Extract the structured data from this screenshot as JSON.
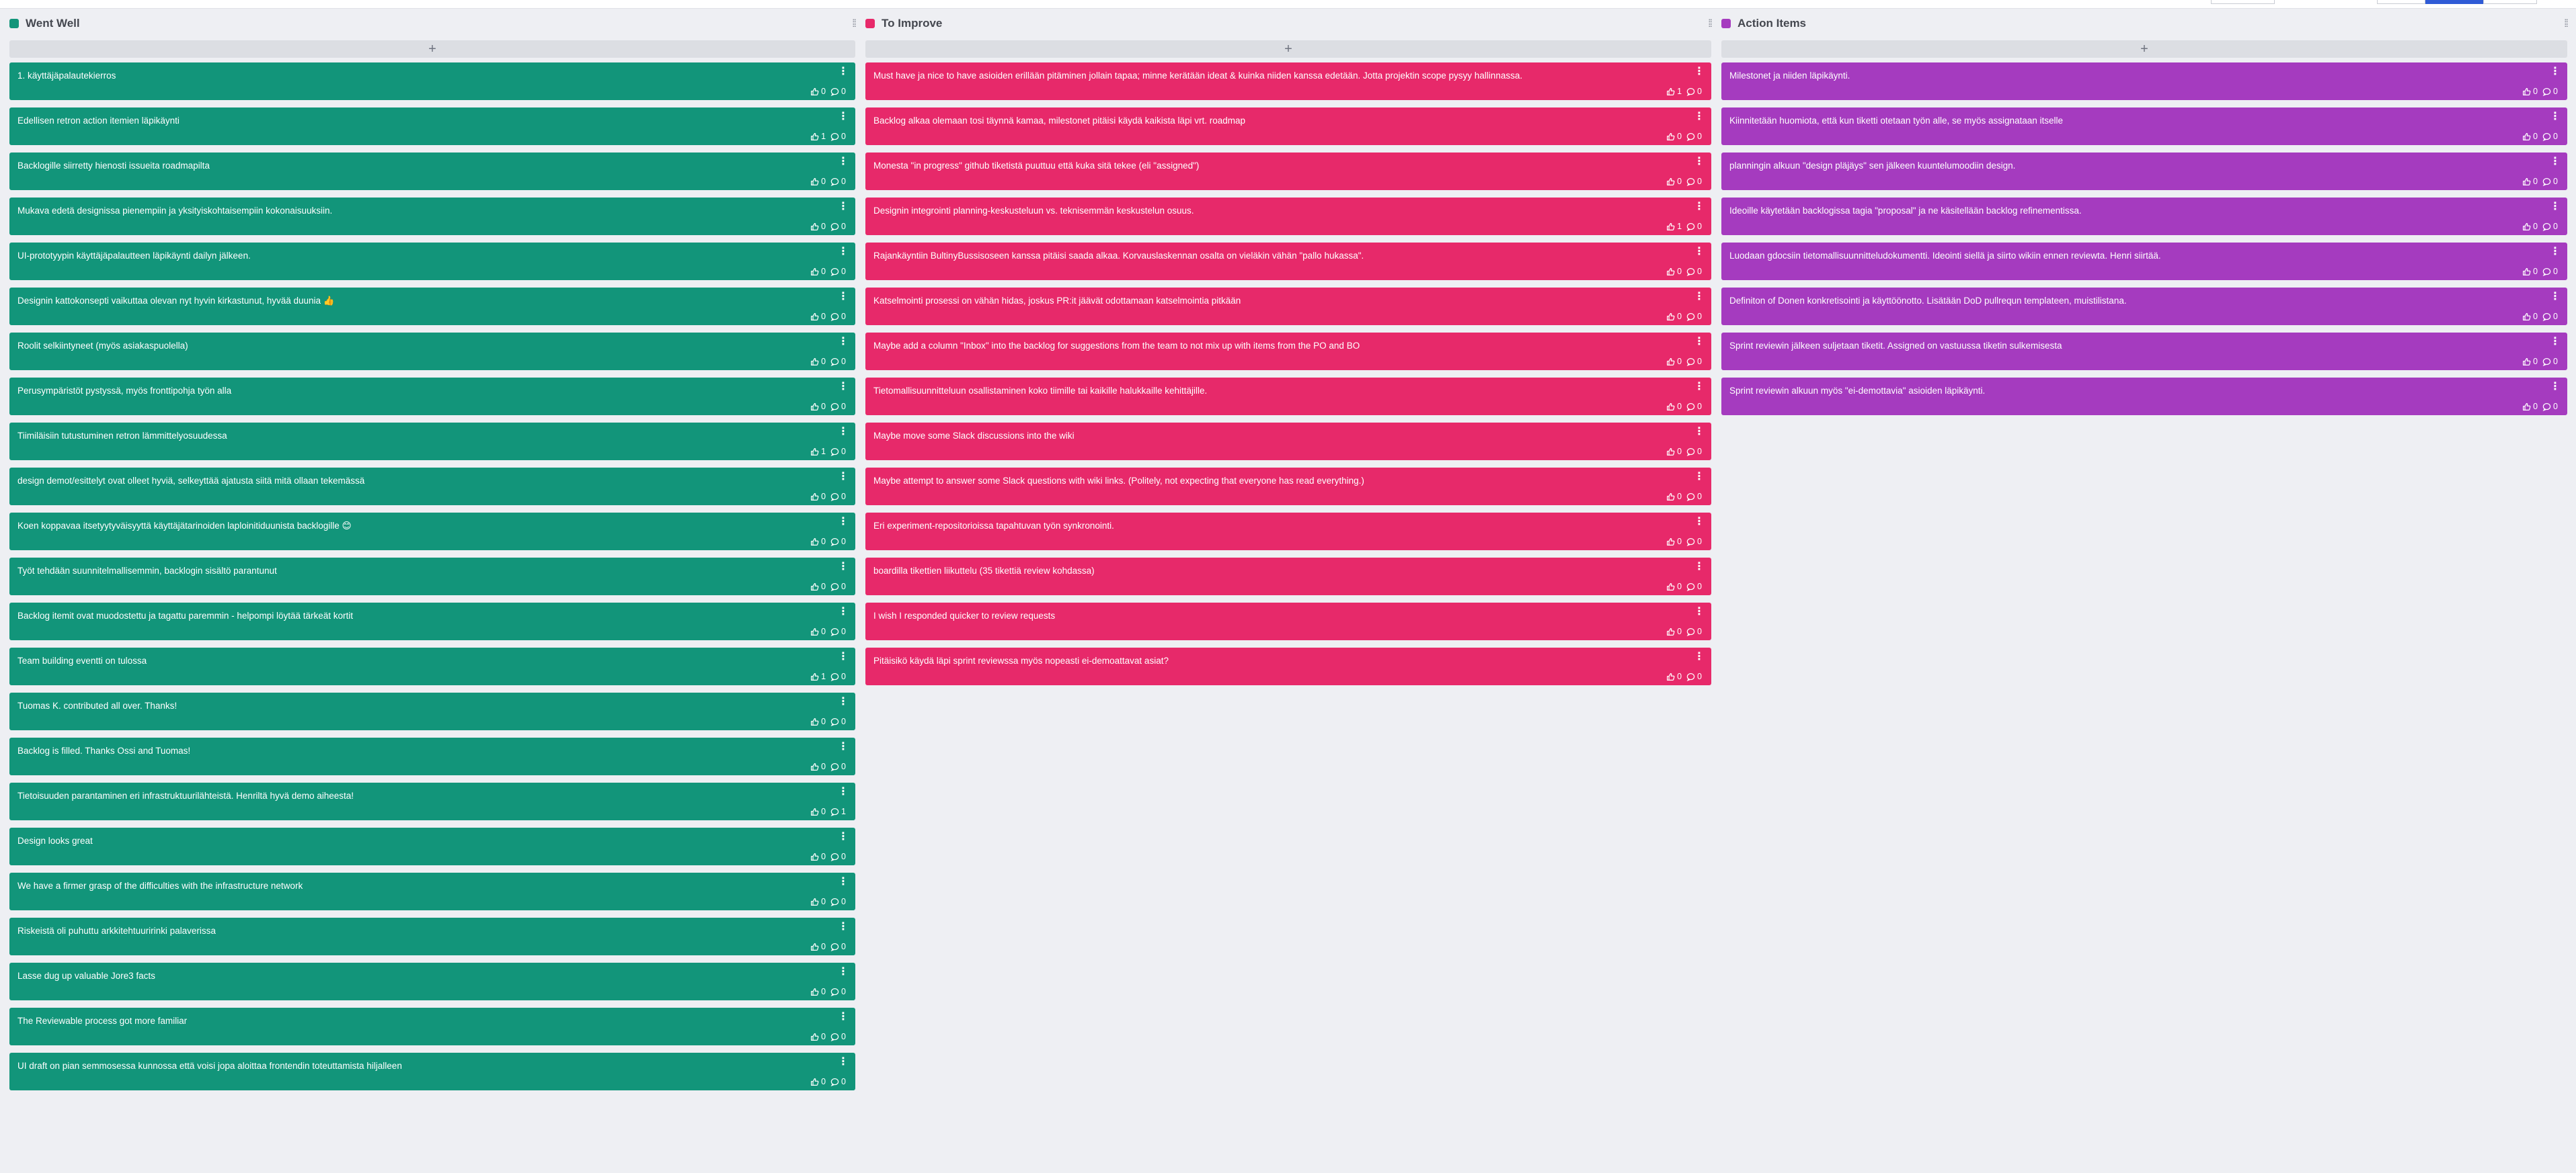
{
  "columns": [
    {
      "title": "Went Well",
      "color": "#12957a",
      "add_symbol": "+",
      "cards": [
        {
          "text": "1. käyttäjäpalautekierros",
          "votes": "0",
          "comments": "0"
        },
        {
          "text": "Edellisen retron action itemien läpikäynti",
          "votes": "1",
          "comments": "0"
        },
        {
          "text": "Backlogille siirretty hienosti issueita roadmapilta",
          "votes": "0",
          "comments": "0"
        },
        {
          "text": "Mukava edetä designissa pienempiin ja yksityiskohtaisempiin kokonaisuuksiin.",
          "votes": "0",
          "comments": "0"
        },
        {
          "text": "UI-prototyypin käyttäjäpalautteen läpikäynti dailyn jälkeen.",
          "votes": "0",
          "comments": "0"
        },
        {
          "text": "Designin kattokonsepti vaikuttaa olevan nyt hyvin kirkastunut, hyvää duunia 👍",
          "votes": "0",
          "comments": "0"
        },
        {
          "text": "Roolit selkiintyneet (myös asiakaspuolella)",
          "votes": "0",
          "comments": "0"
        },
        {
          "text": "Perusympäristöt pystyssä, myös fronttipohja työn alla",
          "votes": "0",
          "comments": "0"
        },
        {
          "text": "Tiimiläisiin tutustuminen retron lämmittelyosuudessa",
          "votes": "1",
          "comments": "0"
        },
        {
          "text": "design demot/esittelyt ovat olleet hyviä, selkeyttää ajatusta siitä mitä ollaan tekemässä",
          "votes": "0",
          "comments": "0"
        },
        {
          "text": "Koen koppavaa itsetyytyväisyyttä käyttäjätarinoiden laploinitiduunista backlogille 😊",
          "votes": "0",
          "comments": "0"
        },
        {
          "text": "Työt tehdään suunnitelmallisemmin, backlogin sisältö parantunut",
          "votes": "0",
          "comments": "0"
        },
        {
          "text": "Backlog itemit ovat muodostettu ja tagattu paremmin - helpompi löytää tärkeät kortit",
          "votes": "0",
          "comments": "0"
        },
        {
          "text": "Team building eventti on tulossa",
          "votes": "1",
          "comments": "0"
        },
        {
          "text": "Tuomas K. contributed all over. Thanks!",
          "votes": "0",
          "comments": "0"
        },
        {
          "text": "Backlog is filled. Thanks Ossi and Tuomas!",
          "votes": "0",
          "comments": "0"
        },
        {
          "text": "Tietoisuuden parantaminen eri infrastruktuurilähteistä. Henriltä hyvä demo aiheesta!",
          "votes": "0",
          "comments": "1"
        },
        {
          "text": "Design looks great",
          "votes": "0",
          "comments": "0"
        },
        {
          "text": "We have a firmer grasp of the difficulties with the infrastructure network",
          "votes": "0",
          "comments": "0"
        },
        {
          "text": "Riskeistä oli puhuttu arkkitehtuuririnki palaverissa",
          "votes": "0",
          "comments": "0"
        },
        {
          "text": "Lasse dug up valuable Jore3 facts",
          "votes": "0",
          "comments": "0"
        },
        {
          "text": "The Reviewable process got more familiar",
          "votes": "0",
          "comments": "0"
        },
        {
          "text": "UI draft on pian semmosessa kunnossa että voisi jopa aloittaa frontendin toteuttamista hiljalleen",
          "votes": "0",
          "comments": "0"
        }
      ]
    },
    {
      "title": "To Improve",
      "color": "#e7296a",
      "add_symbol": "+",
      "cards": [
        {
          "text": "Must have ja nice to have asioiden erillään pitäminen jollain tapaa; minne kerätään ideat & kuinka niiden kanssa edetään. Jotta projektin scope pysyy hallinnassa.",
          "votes": "1",
          "comments": "0"
        },
        {
          "text": "Backlog alkaa olemaan tosi täynnä kamaa, milestonet pitäisi käydä kaikista läpi vrt. roadmap",
          "votes": "0",
          "comments": "0"
        },
        {
          "text": "Monesta \"in progress\" github tiketistä puuttuu että kuka sitä tekee (eli \"assigned\")",
          "votes": "0",
          "comments": "0"
        },
        {
          "text": "Designin integrointi planning-keskusteluun vs. teknisemmän keskustelun osuus.",
          "votes": "1",
          "comments": "0"
        },
        {
          "text": "Rajankäyntiin BultinyBussisoseen kanssa pitäisi saada alkaa. Korvauslaskennan osalta on vieläkin vähän \"pallo hukassa\".",
          "votes": "0",
          "comments": "0"
        },
        {
          "text": "Katselmointi prosessi on vähän hidas, joskus PR:it jäävät odottamaan katselmointia pitkään",
          "votes": "0",
          "comments": "0"
        },
        {
          "text": "Maybe add a column \"Inbox\" into the backlog for suggestions from the team to not mix up with items from the PO and BO",
          "votes": "0",
          "comments": "0"
        },
        {
          "text": "Tietomallisuunnitteluun osallistaminen koko tiimille tai kaikille halukkaille kehittäjille.",
          "votes": "0",
          "comments": "0"
        },
        {
          "text": "Maybe move some Slack discussions into the wiki",
          "votes": "0",
          "comments": "0"
        },
        {
          "text": "Maybe attempt to answer some Slack questions with wiki links. (Politely, not expecting that everyone has read everything.)",
          "votes": "0",
          "comments": "0"
        },
        {
          "text": "Eri experiment-repositorioissa tapahtuvan työn synkronointi.",
          "votes": "0",
          "comments": "0"
        },
        {
          "text": "boardilla tikettien liikuttelu (35 tikettiä review kohdassa)",
          "votes": "0",
          "comments": "0"
        },
        {
          "text": "I wish I responded quicker to review requests",
          "votes": "0",
          "comments": "0"
        },
        {
          "text": "Pitäisikö käydä läpi sprint reviewssa myös nopeasti ei-demoattavat asiat?",
          "votes": "0",
          "comments": "0"
        }
      ]
    },
    {
      "title": "Action Items",
      "color": "#a53bbf",
      "add_symbol": "+",
      "cards": [
        {
          "text": "Milestonet ja niiden läpikäynti.",
          "votes": "0",
          "comments": "0"
        },
        {
          "text": "Kiinnitetään huomiota, että kun tiketti otetaan työn alle, se myös assignataan itselle",
          "votes": "0",
          "comments": "0"
        },
        {
          "text": "planningin alkuun \"design pläjäys\" sen jälkeen kuuntelumoodiin design.",
          "votes": "0",
          "comments": "0"
        },
        {
          "text": "Ideoille käytetään backlogissa tagia \"proposal\" ja ne käsitellään backlog refinementissa.",
          "votes": "0",
          "comments": "0"
        },
        {
          "text": "Luodaan gdocsiin tietomallisuunnitteludokumentti. Ideointi siellä ja siirto wikiin ennen reviewta. Henri siirtää.",
          "votes": "0",
          "comments": "0"
        },
        {
          "text": "Definiton of Donen konkretisointi ja käyttöönotto. Lisätään DoD pullrequn templateen, muistilistana.",
          "votes": "0",
          "comments": "0"
        },
        {
          "text": "Sprint reviewin jälkeen suljetaan tiketit. Assigned on vastuussa tiketin sulkemisesta",
          "votes": "0",
          "comments": "0"
        },
        {
          "text": "Sprint reviewin alkuun myös \"ei-demottavia\" asioiden läpikäynti.",
          "votes": "0",
          "comments": "0"
        }
      ]
    }
  ]
}
